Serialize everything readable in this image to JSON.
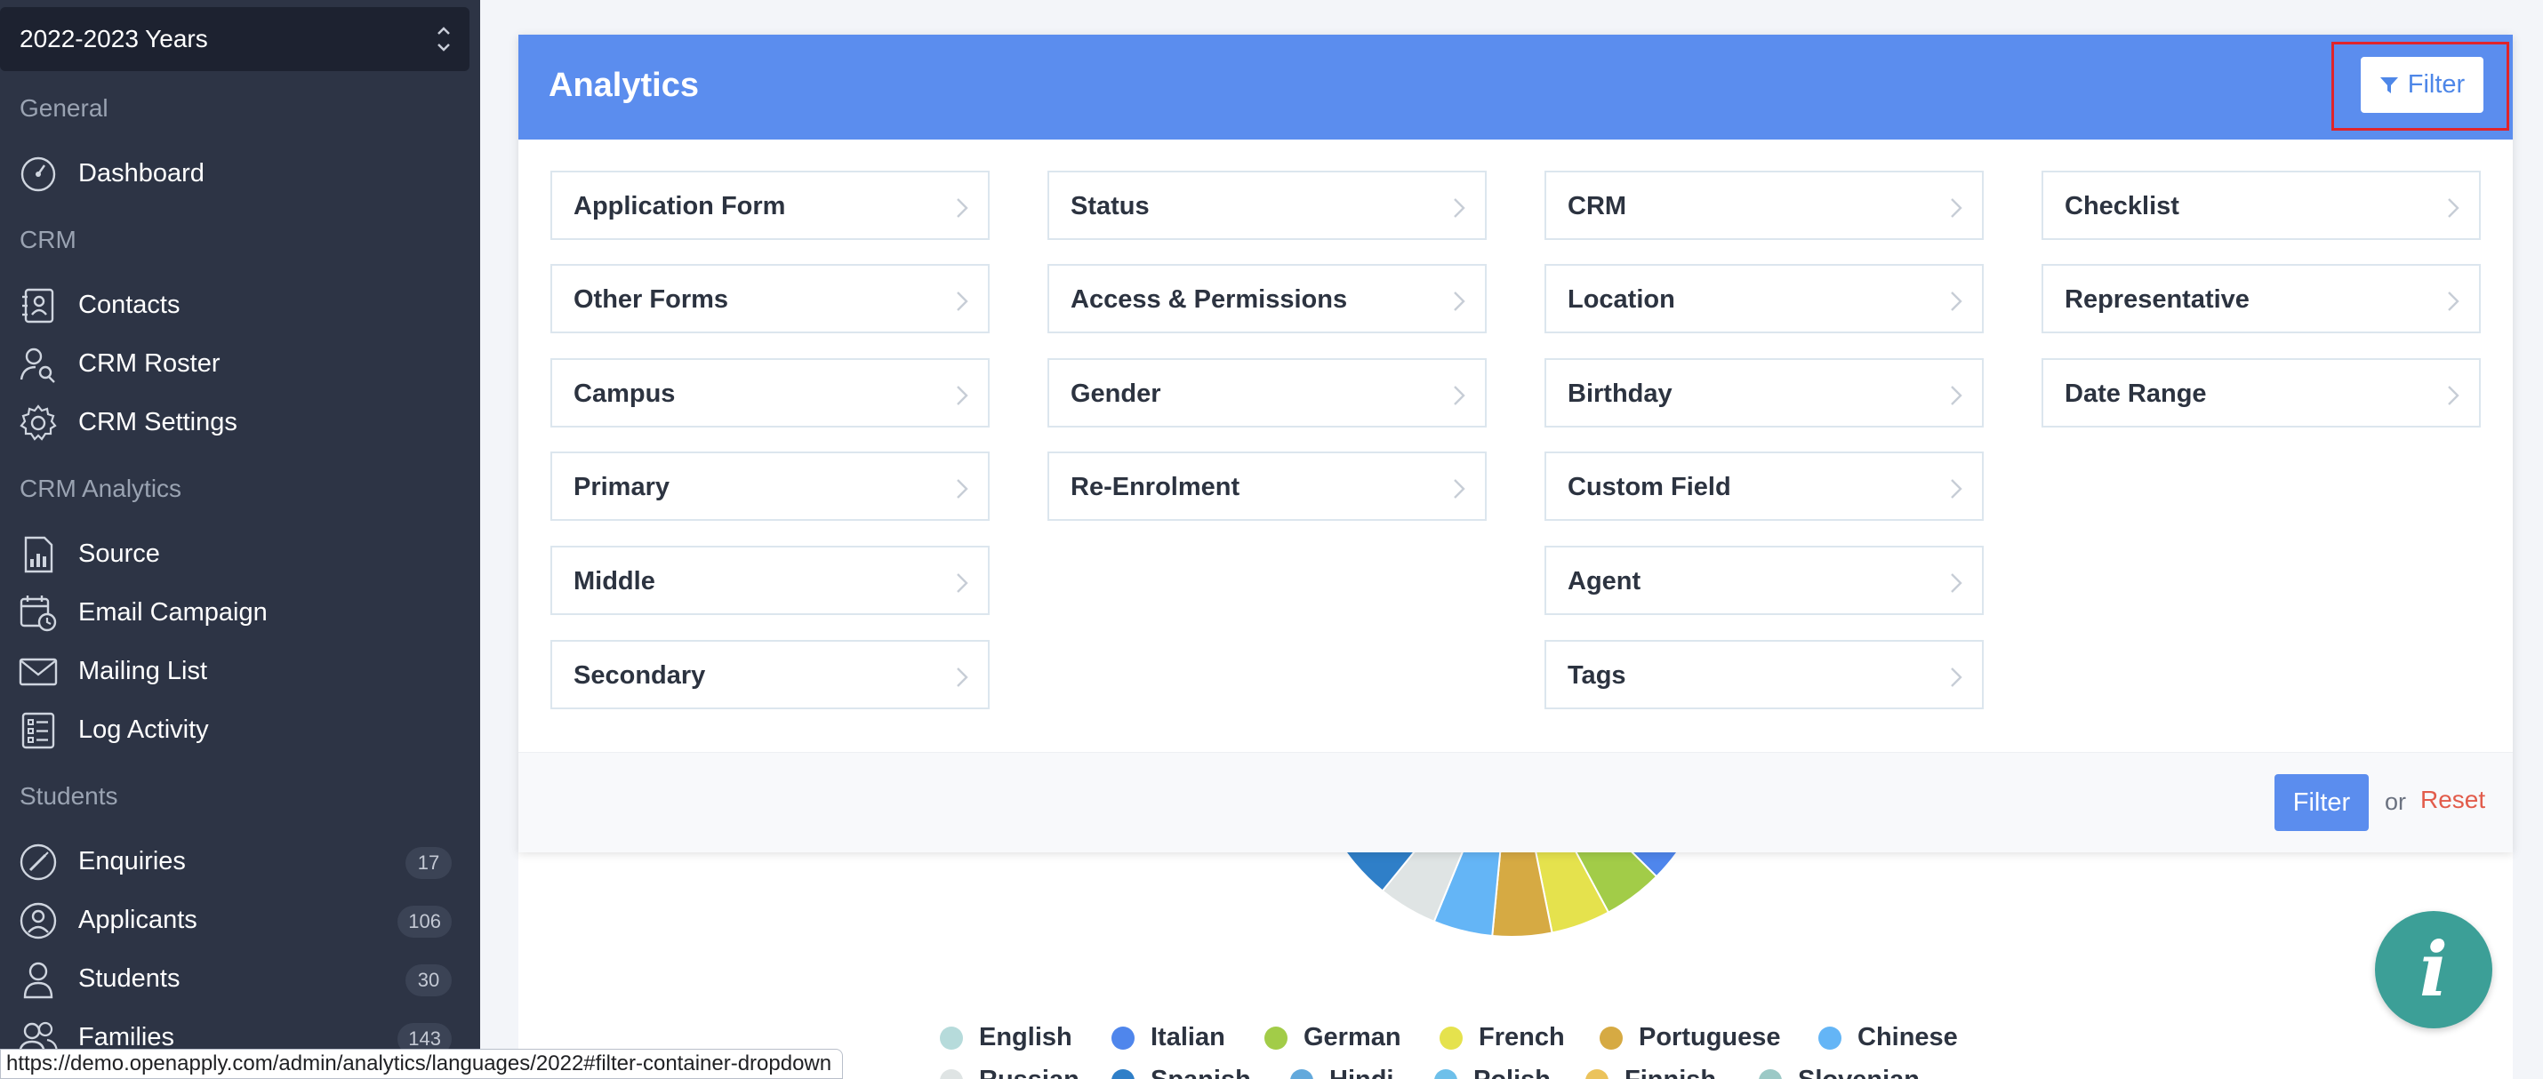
{
  "sidebar": {
    "year_select": "2022-2023 Years",
    "sections": {
      "general": "General",
      "crm": "CRM",
      "crm_analytics": "CRM Analytics",
      "students": "Students"
    },
    "items": {
      "dashboard": "Dashboard",
      "contacts": "Contacts",
      "crm_roster": "CRM Roster",
      "crm_settings": "CRM Settings",
      "source": "Source",
      "email_campaign": "Email Campaign",
      "mailing_list": "Mailing List",
      "log_activity": "Log Activity",
      "enquiries": {
        "label": "Enquiries",
        "count": "17"
      },
      "applicants": {
        "label": "Applicants",
        "count": "106"
      },
      "students": {
        "label": "Students",
        "count": "30"
      },
      "families": {
        "label": "Families",
        "count": "143"
      }
    }
  },
  "card": {
    "title": "Analytics",
    "filter_button": "Filter"
  },
  "filters": {
    "col1": [
      "Application Form",
      "Other Forms",
      "Campus",
      "Primary",
      "Middle",
      "Secondary"
    ],
    "col2": [
      "Status",
      "Access & Permissions",
      "Gender",
      "Re-Enrolment"
    ],
    "col3": [
      "CRM",
      "Location",
      "Birthday",
      "Custom Field",
      "Agent",
      "Tags"
    ],
    "col4": [
      "Checklist",
      "Representative",
      "Date Range"
    ]
  },
  "footer": {
    "apply": "Filter",
    "or": "or",
    "reset": "Reset"
  },
  "chart_data": {
    "type": "pie",
    "legend_placement": "bottom",
    "visible_slice_colors": [
      "#2f7fc8",
      "#dfe4e4",
      "#64b5f6",
      "#d6aa43",
      "#e5e24d",
      "#a2cc48",
      "#4f86ec"
    ],
    "legend": {
      "row1": [
        {
          "label": "English",
          "color": "#b6dbdb"
        },
        {
          "label": "Italian",
          "color": "#4f86ec"
        },
        {
          "label": "German",
          "color": "#a2cc48"
        },
        {
          "label": "French",
          "color": "#e5e24d"
        },
        {
          "label": "Portuguese",
          "color": "#d6aa43"
        },
        {
          "label": "Chinese",
          "color": "#64b5f6"
        }
      ],
      "row2": [
        {
          "label": "Russian",
          "color": "#dfe4e4"
        },
        {
          "label": "Spanish",
          "color": "#2f7fc8"
        },
        {
          "label": "Hindi",
          "color": "#63a9dc"
        },
        {
          "label": "Polish",
          "color": "#6ec0ea"
        },
        {
          "label": "Finnish",
          "color": "#ebc35c"
        },
        {
          "label": "Slovenian",
          "color": "#9cc9c6"
        }
      ]
    }
  },
  "info_button": "i",
  "status_url": "https://demo.openapply.com/admin/analytics/languages/2022#filter-container-dropdown"
}
